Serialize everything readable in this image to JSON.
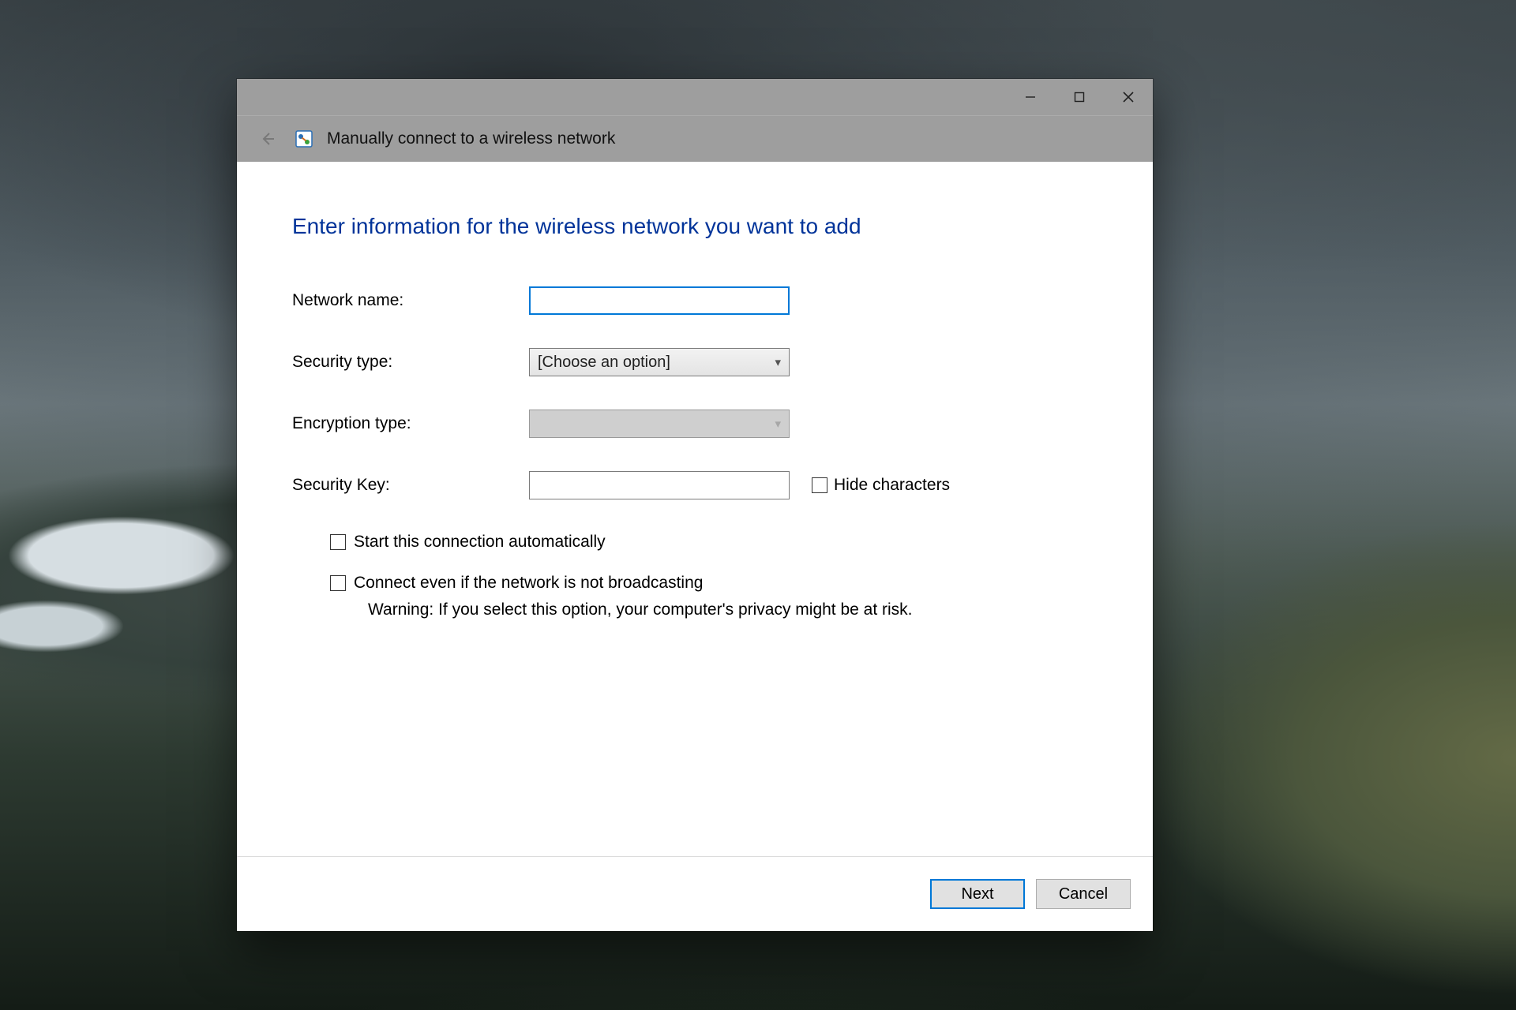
{
  "window": {
    "title": "Manually connect to a wireless network"
  },
  "heading": "Enter information for the wireless network you want to add",
  "fields": {
    "network_name": {
      "label": "Network name:",
      "value": ""
    },
    "security_type": {
      "label": "Security type:",
      "selected": "[Choose an option]"
    },
    "encryption_type": {
      "label": "Encryption type:",
      "selected": ""
    },
    "security_key": {
      "label": "Security Key:",
      "value": ""
    }
  },
  "hide_characters_label": "Hide characters",
  "options": {
    "auto_start": "Start this connection automatically",
    "connect_hidden": "Connect even if the network is not broadcasting",
    "warning": "Warning: If you select this option, your computer's privacy might be at risk."
  },
  "buttons": {
    "next": "Next",
    "cancel": "Cancel"
  }
}
